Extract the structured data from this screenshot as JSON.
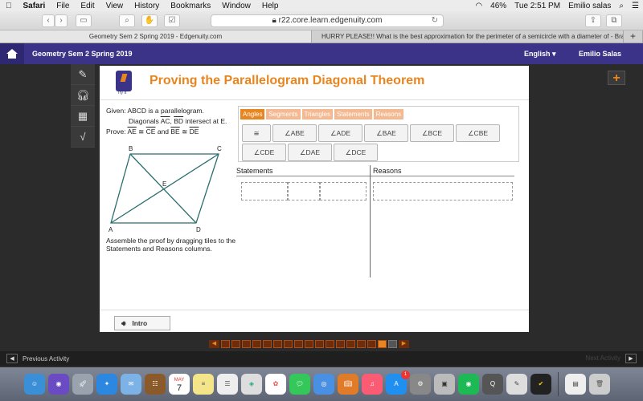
{
  "menubar": {
    "apple": "",
    "app": "Safari",
    "menus": [
      "File",
      "Edit",
      "View",
      "History",
      "Bookmarks",
      "Window",
      "Help"
    ],
    "battery": "46%",
    "clock": "Tue 2:51 PM",
    "user": "Emilio salas"
  },
  "browser": {
    "url": "r22.core.learn.edgenuity.com",
    "tabs": [
      "Geometry Sem 2 Spring 2019 - Edgenuity.com",
      "HURRY PLEASE!! What is the best approximation for the perimeter of a semicircle with a diameter of - Brai..."
    ],
    "new_tab": "+"
  },
  "course": {
    "title": "Geometry Sem 2 Spring 2019",
    "language": "English",
    "user": "Emilio Salas"
  },
  "lesson": {
    "try_it": "Try It",
    "title": "Proving the Parallelogram Diagonal Theorem",
    "given1": "Given: ABCD is a parallelogram.",
    "given2_pre": "Diagonals ",
    "given2_ac": "AC",
    "given2_mid": ", ",
    "given2_bd": "BD",
    "given2_post": " intersect at E.",
    "prove_pre": "Prove: ",
    "prove_ae": "AE",
    "prove_cong1": " ≅ ",
    "prove_ce": "CE",
    "prove_and": " and ",
    "prove_be": "BE",
    "prove_cong2": " ≅ ",
    "prove_de": "DE",
    "vertices": {
      "a": "A",
      "b": "B",
      "c": "C",
      "d": "D",
      "e": "E"
    },
    "instructions": "Assemble the proof by dragging tiles to the Statements and Reasons columns."
  },
  "tiles": {
    "tabs": [
      "Angles",
      "Segments",
      "Triangles",
      "Statements",
      "Reasons"
    ],
    "active_tab": "Angles",
    "row1": [
      "≅",
      "∠ABE",
      "∠ADE",
      "∠BAE",
      "∠BCE",
      "∠CBE"
    ],
    "row2": [
      "∠CDE",
      "∠DAE",
      "∠DCE"
    ]
  },
  "proof": {
    "statements_header": "Statements",
    "reasons_header": "Reasons"
  },
  "footer": {
    "intro_label": "Intro",
    "progress_total": 17,
    "progress_current": 16,
    "prev_activity": "Previous Activity",
    "next_activity": "Next Activity"
  },
  "dock": {
    "calendar_month": "MAY",
    "calendar_day": "7",
    "appstore_badge": "1"
  },
  "colors": {
    "accent": "#e8851f",
    "brand": "#3b3387"
  }
}
